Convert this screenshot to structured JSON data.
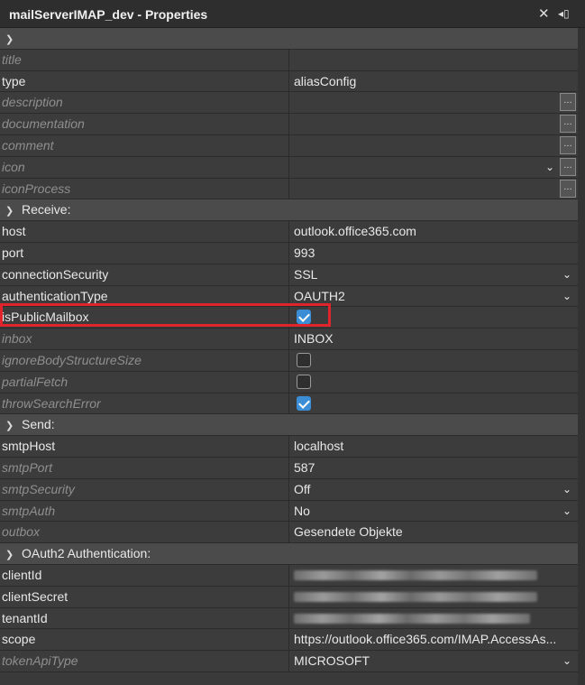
{
  "window": {
    "title": "mailServerIMAP_dev - Properties",
    "close_icon": "close-icon",
    "pin_icon": "pin-icon"
  },
  "general": [
    {
      "name": "title",
      "value": "",
      "muted": true
    },
    {
      "name": "type",
      "value": "aliasConfig",
      "muted": false
    },
    {
      "name": "description",
      "value": "",
      "muted": true,
      "ellipsis": true
    },
    {
      "name": "documentation",
      "value": "",
      "muted": true,
      "ellipsis": true
    },
    {
      "name": "comment",
      "value": "",
      "muted": true,
      "ellipsis": true
    },
    {
      "name": "icon",
      "value": "",
      "muted": true,
      "ellipsis": true,
      "dropdown": true
    },
    {
      "name": "iconProcess",
      "value": "",
      "muted": true,
      "ellipsis": true
    }
  ],
  "receive": {
    "label": "Receive:",
    "rows": [
      {
        "name": "host",
        "value": "outlook.office365.com",
        "muted": false
      },
      {
        "name": "port",
        "value": "993",
        "muted": false
      },
      {
        "name": "connectionSecurity",
        "value": "SSL",
        "muted": false,
        "dropdown": true
      },
      {
        "name": "authenticationType",
        "value": "OAUTH2",
        "muted": false,
        "dropdown": true
      },
      {
        "name": "isPublicMailbox",
        "checked": true,
        "muted": false
      },
      {
        "name": "inbox",
        "value": "INBOX",
        "muted": true
      },
      {
        "name": "ignoreBodyStructureSize",
        "checked": false,
        "muted": true
      },
      {
        "name": "partialFetch",
        "checked": false,
        "muted": true
      },
      {
        "name": "throwSearchError",
        "checked": true,
        "muted": true
      }
    ]
  },
  "send": {
    "label": "Send:",
    "rows": [
      {
        "name": "smtpHost",
        "value": "localhost",
        "muted": false
      },
      {
        "name": "smtpPort",
        "value": "587",
        "muted": true
      },
      {
        "name": "smtpSecurity",
        "value": "Off",
        "muted": true,
        "dropdown": true
      },
      {
        "name": "smtpAuth",
        "value": "No",
        "muted": true,
        "dropdown": true
      },
      {
        "name": "outbox",
        "value": "Gesendete Objekte",
        "muted": true
      }
    ]
  },
  "oauth": {
    "label": "OAuth2 Authentication:",
    "rows": [
      {
        "name": "clientId",
        "muted": false
      },
      {
        "name": "clientSecret",
        "muted": false
      },
      {
        "name": "tenantId",
        "muted": false
      },
      {
        "name": "scope",
        "value": "https://outlook.office365.com/IMAP.AccessAs...",
        "muted": false
      },
      {
        "name": "tokenApiType",
        "value": "MICROSOFT",
        "muted": true,
        "dropdown": true
      }
    ]
  },
  "colors": {
    "accent": "#3b8ed6",
    "highlight": "#e0242c"
  }
}
